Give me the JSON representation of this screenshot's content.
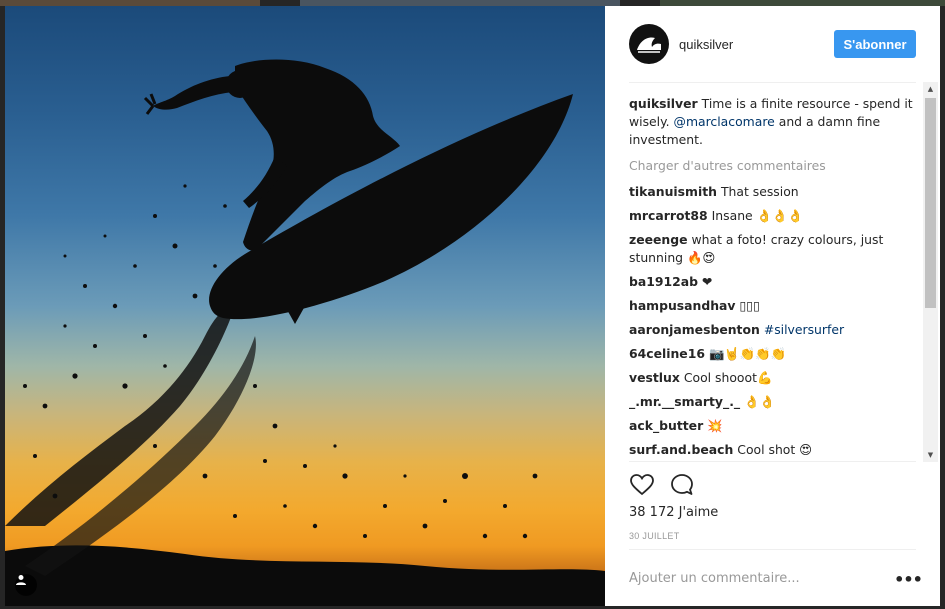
{
  "post": {
    "username": "quiksilver",
    "follow_label": "S'abonner",
    "caption": {
      "username": "quiksilver",
      "text_before": "Time is a finite resource - spend it wisely. ",
      "mention": "@marclacomare",
      "text_after": " and a damn fine investment."
    },
    "load_more": "Charger d'autres commentaires",
    "comments": [
      {
        "username": "tikanuismith",
        "text": "That session"
      },
      {
        "username": "mrcarrot88",
        "text": "Insane 👌👌👌"
      },
      {
        "username": "zeeenge",
        "text": "what a foto! crazy colours, just stunning 🔥😍"
      },
      {
        "username": "ba1912ab",
        "text": "❤"
      },
      {
        "username": "hampusandhav",
        "text": "▯▯▯"
      },
      {
        "username": "aaronjamesbenton",
        "text": "#silversurfer"
      },
      {
        "username": "64celine16",
        "text": "📷🤘👏👏👏"
      },
      {
        "username": "vestlux",
        "text": "Cool shooot💪"
      },
      {
        "username": "_.mr.__smarty_._",
        "text": "👌👌"
      },
      {
        "username": "ack_butter",
        "text": "💥"
      },
      {
        "username": "surf.and.beach",
        "text": "Cool shot 😍"
      }
    ],
    "likes": "38 172 J'aime",
    "date": "30 JUILLET",
    "add_comment_placeholder": "Ajouter un commentaire...",
    "more_label": "•••"
  },
  "icons": {
    "heart": "heart-icon",
    "comment": "comment-icon",
    "user_tag": "user-icon",
    "avatar": "quiksilver-logo-icon"
  },
  "colors": {
    "accent": "#3897f0",
    "link": "#003569",
    "muted": "#999999",
    "text": "#262626"
  }
}
